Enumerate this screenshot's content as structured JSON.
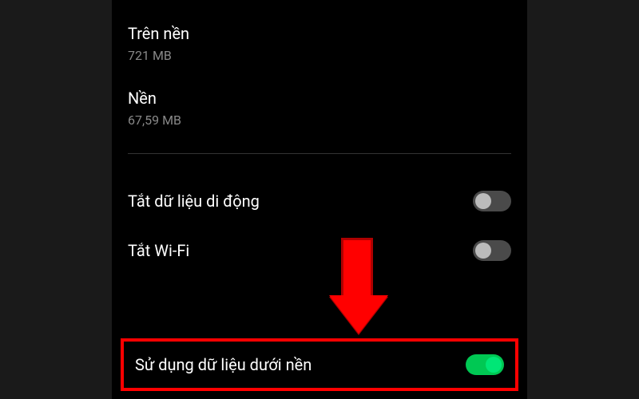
{
  "stats": {
    "foreground": {
      "label": "Trên nền",
      "value": "721 MB"
    },
    "background": {
      "label": "Nền",
      "value": "67,59 MB"
    }
  },
  "toggles": {
    "mobile_data": {
      "label": "Tắt dữ liệu di động",
      "state": "off"
    },
    "wifi": {
      "label": "Tắt Wi-Fi",
      "state": "off"
    },
    "background_data": {
      "label": "Sử dụng dữ liệu dưới nền",
      "state": "on"
    }
  }
}
